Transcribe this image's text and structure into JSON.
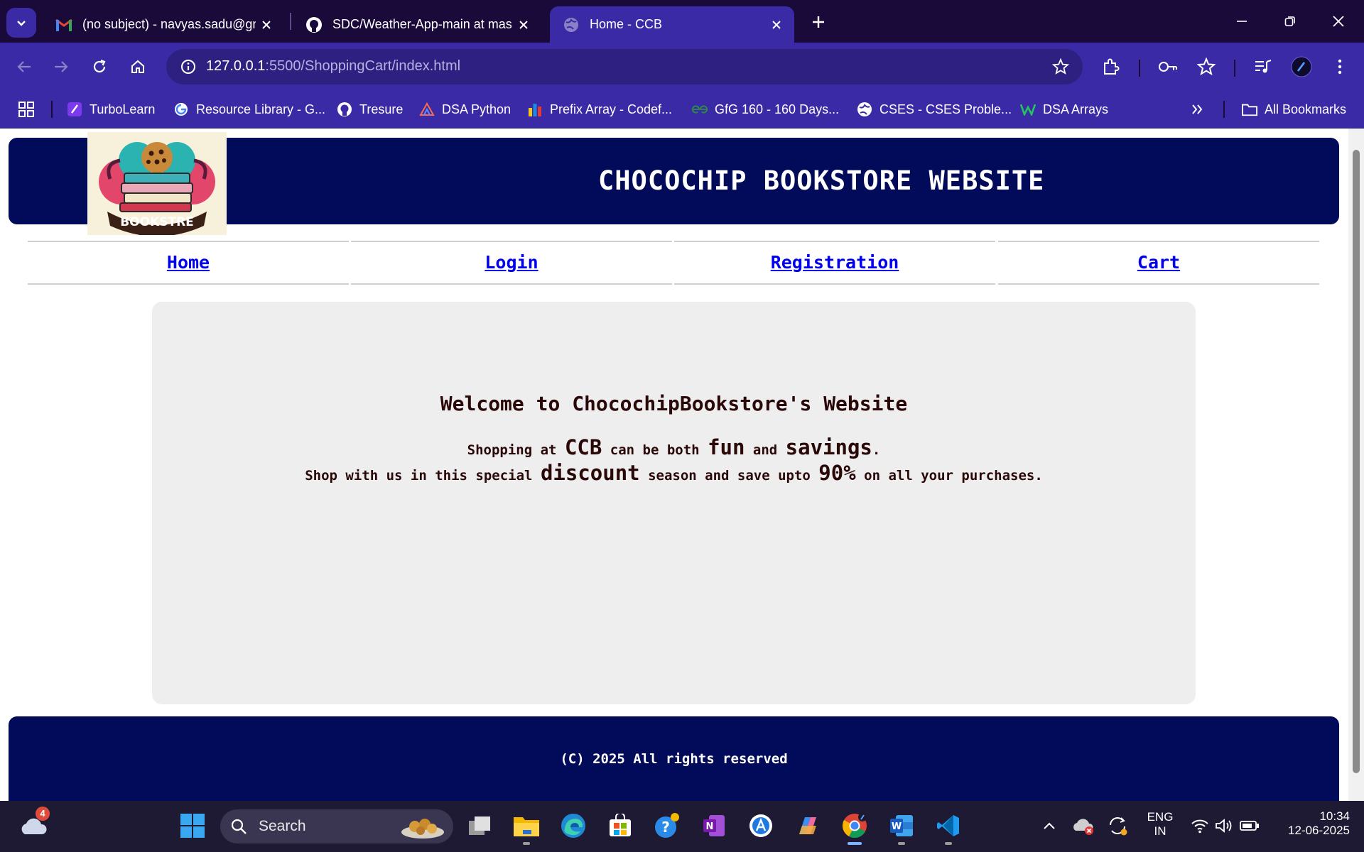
{
  "browser": {
    "tabs": [
      {
        "title": "(no subject) - navyas.sadu@gm",
        "icon": "gmail-icon"
      },
      {
        "title": "SDC/Weather-App-main at mas",
        "icon": "github-icon"
      },
      {
        "title": "Home - CCB",
        "icon": "globe-icon",
        "active": true
      }
    ],
    "url_host": "127.0.0.1",
    "url_rest": ":5500/ShoppingCart/index.html",
    "bookmarks": [
      {
        "label": "TurboLearn",
        "icon": "turbolearn-icon"
      },
      {
        "label": "Resource Library - G...",
        "icon": "google-icon"
      },
      {
        "label": "Tresure",
        "icon": "github-icon"
      },
      {
        "label": "DSA Python",
        "icon": "dsa-python-icon"
      },
      {
        "label": "Prefix Array - Codef...",
        "icon": "codeforces-icon"
      },
      {
        "label": "GfG 160 - 160 Days...",
        "icon": "gfg-icon"
      },
      {
        "label": "CSES - CSES Proble...",
        "icon": "globe-icon"
      },
      {
        "label": "DSA Arrays",
        "icon": "dsa-arrays-icon"
      }
    ],
    "all_bookmarks": "All Bookmarks"
  },
  "site": {
    "title": "CHOCOCHIP BOOKSTORE WEBSITE",
    "logo_text": "BOOKSTRE",
    "nav": [
      "Home",
      "Login",
      "Registration",
      "Cart"
    ],
    "welcome": "Welcome to ChocochipBookstore's Website",
    "line1": {
      "a": "Shopping at ",
      "b": "CCB",
      "c": " can be both ",
      "d": "fun",
      "e": " and ",
      "f": "savings",
      "g": "."
    },
    "line2": {
      "a": "Shop with us in this special ",
      "b": "discount",
      "c": " season and save upto ",
      "d": "90%",
      "e": " on all your purchases."
    },
    "footer": "(C) 2025 All rights reserved"
  },
  "taskbar": {
    "weather_badge": "4",
    "search_placeholder": "Search",
    "lang_line1": "ENG",
    "lang_line2": "IN",
    "time": "10:34",
    "date": "12-06-2025"
  },
  "colors": {
    "chrome_dark": "#1a0a3a",
    "chrome_accent": "#3b2aa6",
    "site_navy": "#020a5a",
    "link_blue": "#0000ee",
    "content_bg": "#eeeeee"
  }
}
